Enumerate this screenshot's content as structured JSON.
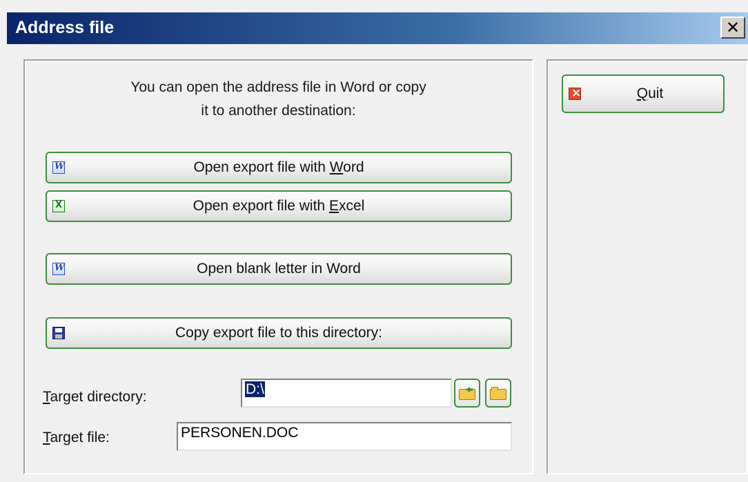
{
  "window": {
    "title": "Address file",
    "close_glyph": "✕"
  },
  "intro": {
    "line1": "You can open the address file in Word or copy",
    "line2": "it to another destination:"
  },
  "buttons": {
    "open_word": {
      "pre": "Open export file with ",
      "mnemonic": "W",
      "post": "ord",
      "icon": "word-icon"
    },
    "open_excel": {
      "pre": "Open export file with ",
      "mnemonic": "E",
      "post": "xcel",
      "icon": "excel-icon"
    },
    "open_blank_letter": {
      "label": "Open blank letter in Word",
      "icon": "word-icon"
    },
    "copy_export": {
      "label": "Copy export file to this directory:",
      "icon": "floppy-disk-icon"
    },
    "quit": {
      "mnemonic": "Q",
      "post": "uit",
      "icon": "quit-icon"
    }
  },
  "fields": {
    "target_directory": {
      "label_mnemonic": "T",
      "label_rest": "arget directory:",
      "value": "D:\\"
    },
    "target_file": {
      "label_mnemonic": "T",
      "label_rest": "arget file:",
      "value": "PERSONEN.DOC"
    }
  },
  "colors": {
    "titlebar_start": "#0a246a",
    "titlebar_end": "#a6caf0",
    "button_border": "#3e8e3e",
    "selection": "#0a246a"
  }
}
